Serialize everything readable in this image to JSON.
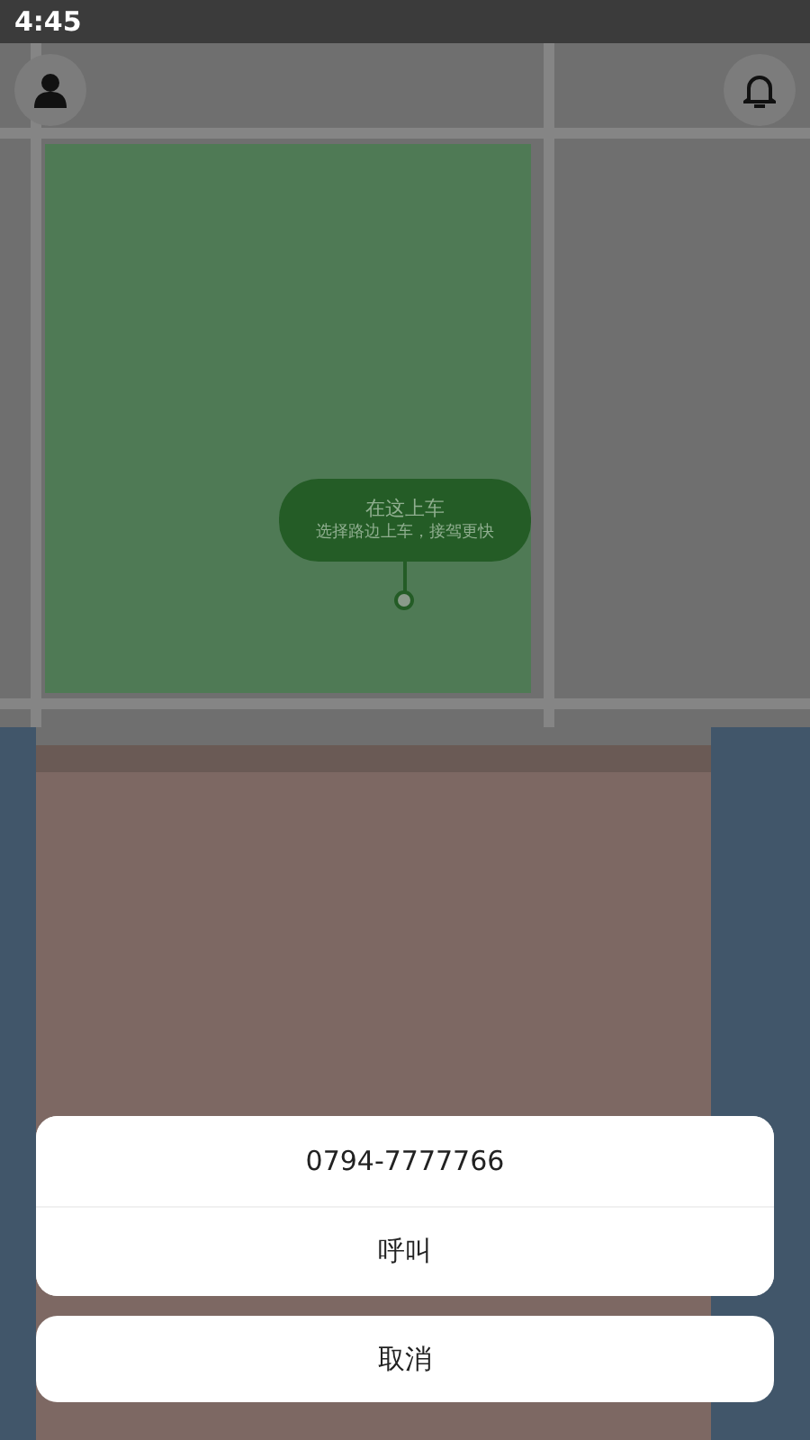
{
  "status_bar": {
    "time": "4:45"
  },
  "pickup_bubble": {
    "title": "在这上车",
    "subtitle": "选择路边上车，接驾更快"
  },
  "call_sheet": {
    "phone": "0794-7777766",
    "call_button": "呼叫",
    "cancel_button": "取消"
  }
}
